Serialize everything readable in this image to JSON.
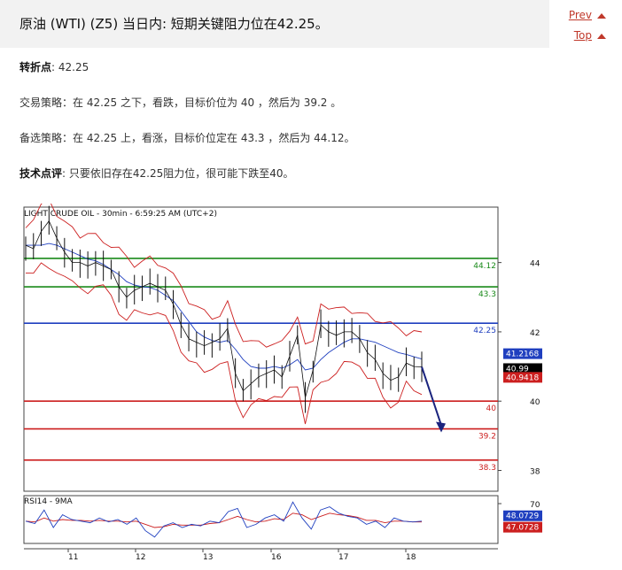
{
  "header": {
    "title": "原油 (WTI) (Z5) 当日内: 短期关键阻力位在42.25。",
    "prev_label": "Prev",
    "top_label": "Top"
  },
  "analysis": {
    "pivot_label": "转折点",
    "pivot_value": ": 42.25",
    "strategy_label": "交易策略",
    "strategy_text": "：在 42.25 之下，看跌，目标价位为 40 ，然后为 39.2 。",
    "alt_label": "备选策略",
    "alt_text": "：在 42.25 上，看涨，目标价位定在 43.3 ，然后为 44.12。",
    "comment_label": "技术点评",
    "comment_text": ": 只要依旧存在42.25阻力位，很可能下跌至40。"
  },
  "chart_data": {
    "type": "line",
    "title": "LIGHT CRUDE OIL - 30min - 6:59:25 AM (UTC+2)",
    "y_ticks": [
      "44",
      "42",
      "40",
      "38"
    ],
    "x_ticks": [
      "11",
      "12",
      "13",
      "16",
      "17",
      "18"
    ],
    "ylim": [
      37.4,
      45.6
    ],
    "levels": [
      {
        "value": 44.12,
        "label": "44.12",
        "color": "#1a8a1a"
      },
      {
        "value": 43.3,
        "label": "43.3",
        "color": "#1a8a1a"
      },
      {
        "value": 42.25,
        "label": "42.25",
        "color": "#1f3fbf"
      },
      {
        "value": 40.0,
        "label": "40",
        "color": "#cc1f1f"
      },
      {
        "value": 39.2,
        "label": "39.2",
        "color": "#cc1f1f"
      },
      {
        "value": 38.3,
        "label": "38.3",
        "color": "#cc1f1f"
      }
    ],
    "badges": [
      {
        "value": 41.2168,
        "label": "41.2168",
        "color": "#1f3fbf"
      },
      {
        "value": 40.99,
        "label": "40.99",
        "color": "#000000"
      },
      {
        "value": 40.9418,
        "label": "40.9418",
        "color": "#cc1f1f"
      }
    ],
    "price": [
      44.5,
      44.4,
      44.9,
      45.2,
      44.7,
      44.3,
      44.0,
      44.0,
      43.9,
      44.0,
      43.9,
      43.8,
      43.3,
      43.0,
      43.2,
      43.3,
      43.4,
      43.3,
      43.2,
      42.8,
      42.2,
      41.8,
      41.7,
      41.6,
      41.7,
      41.8,
      42.1,
      40.8,
      40.3,
      40.5,
      40.7,
      40.8,
      40.9,
      40.7,
      41.3,
      41.9,
      40.1,
      40.9,
      42.2,
      42.0,
      41.9,
      42.0,
      42.0,
      41.8,
      41.4,
      41.2,
      40.8,
      40.6,
      40.7,
      41.1,
      41.0,
      40.99
    ],
    "ma": [
      44.5,
      44.5,
      44.5,
      44.55,
      44.5,
      44.4,
      44.3,
      44.2,
      44.1,
      44.05,
      43.95,
      43.8,
      43.65,
      43.45,
      43.35,
      43.3,
      43.28,
      43.2,
      43.05,
      42.9,
      42.6,
      42.3,
      42.0,
      41.85,
      41.75,
      41.7,
      41.75,
      41.5,
      41.2,
      41.0,
      40.95,
      40.95,
      41.0,
      40.95,
      41.05,
      41.2,
      40.9,
      40.95,
      41.2,
      41.4,
      41.55,
      41.7,
      41.8,
      41.8,
      41.75,
      41.7,
      41.6,
      41.5,
      41.4,
      41.35,
      41.28,
      41.2168
    ],
    "rsi": {
      "label": "RSI14 - 9MA",
      "ylim": [
        20,
        80
      ],
      "tick": "70",
      "values": [
        48,
        45,
        62,
        40,
        56,
        50,
        48,
        46,
        52,
        47,
        50,
        44,
        52,
        36,
        28,
        42,
        46,
        40,
        44,
        42,
        48,
        46,
        60,
        64,
        40,
        44,
        52,
        56,
        48,
        72,
        52,
        38,
        62,
        66,
        58,
        54,
        52,
        44,
        48,
        40,
        52,
        48,
        47,
        48
      ],
      "ma_values": [
        48,
        47,
        52,
        48,
        50,
        49,
        49,
        48,
        49,
        48,
        48,
        47,
        48,
        44,
        40,
        41,
        44,
        43,
        43,
        43,
        45,
        46,
        50,
        54,
        50,
        47,
        48,
        51,
        50,
        58,
        56,
        50,
        54,
        58,
        56,
        55,
        53,
        49,
        49,
        46,
        48,
        48,
        47,
        47
      ],
      "badges": [
        {
          "value": 48.0729,
          "label": "48.0729",
          "color": "#1f3fbf"
        },
        {
          "value": 47.0728,
          "label": "47.0728",
          "color": "#cc1f1f"
        }
      ]
    }
  }
}
